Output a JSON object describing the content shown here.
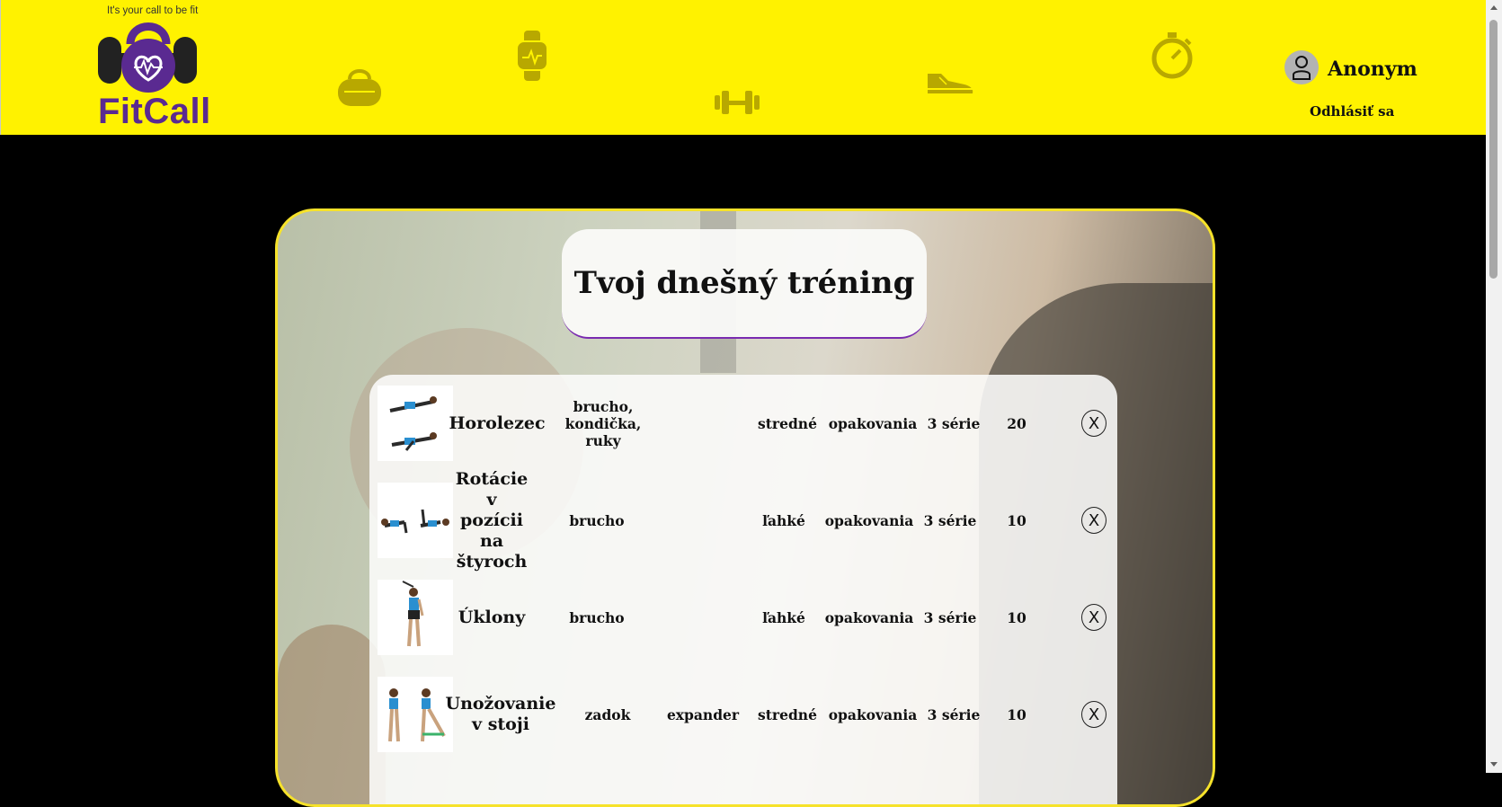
{
  "header": {
    "tagline": "It's your call to be fit",
    "brand": "FitCall",
    "user_name": "Anonym",
    "logout_label": "Odhlásiť sa"
  },
  "main": {
    "title": "Tvoj dnešný tréning",
    "exercises": [
      {
        "name": "Horolezec",
        "muscles": "brucho, kondička, ruky",
        "equipment": "",
        "difficulty": "stredné",
        "type": "opakovania",
        "sets": "3 série",
        "count": "20",
        "delete_label": "X"
      },
      {
        "name": "Rotácie v pozícii na štyroch",
        "muscles": "brucho",
        "equipment": "",
        "difficulty": "ľahké",
        "type": "opakovania",
        "sets": "3 série",
        "count": "10",
        "delete_label": "X"
      },
      {
        "name": "Úklony",
        "muscles": "brucho",
        "equipment": "",
        "difficulty": "ľahké",
        "type": "opakovania",
        "sets": "3 série",
        "count": "10",
        "delete_label": "X"
      },
      {
        "name": "Unožovanie v stoji",
        "muscles": "zadok",
        "equipment": "expander",
        "difficulty": "stredné",
        "type": "opakovania",
        "sets": "3 série",
        "count": "10",
        "delete_label": "X"
      }
    ]
  },
  "colors": {
    "header_bg": "#fff200",
    "brand_purple": "#5a2a91",
    "card_border": "#f6e22a",
    "page_bg": "#000000"
  },
  "icons": [
    "kettlebell-logo-icon",
    "gym-bag-icon",
    "smartwatch-icon",
    "dumbbell-icon",
    "sneaker-icon",
    "stopwatch-icon",
    "user-icon"
  ]
}
